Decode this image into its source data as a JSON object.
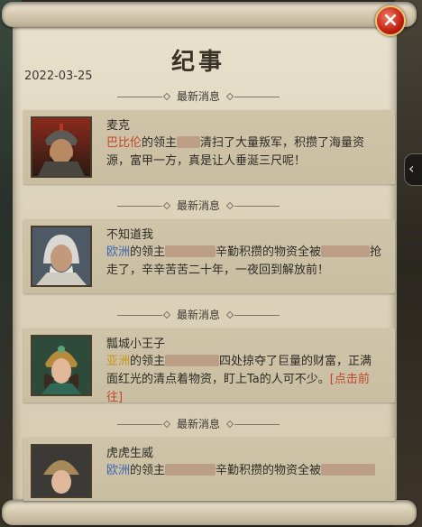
{
  "window": {
    "title": "纪事",
    "date": "2022-03-25",
    "close_icon": "×",
    "side_arrow_icon": "‹"
  },
  "section_label": "最新消息",
  "entries": [
    {
      "name": "麦克",
      "region": "巴比伦",
      "region_color": "#c1472c",
      "text1": "的领主",
      "text2": "清扫了大量叛军，积攒了海量资源，富甲一方，真是让人垂涎三尺呢！"
    },
    {
      "name": "不知道我",
      "region": "欧洲",
      "region_color": "#3f68b0",
      "text1": "的领主",
      "text2": "辛勤积攒的物资全被",
      "text3": "抢走了，辛辛苦苦二十年，一夜回到解放前！"
    },
    {
      "name": "瓢城小王子",
      "region": "亚洲",
      "region_color": "#c2951b",
      "text1": "的领主",
      "text2": "四处掠夺了巨量的财富，正满面红光的清点着物资，盯上Ta的人可不少。",
      "link": "[点击前往]"
    },
    {
      "name": "虎虎生威",
      "region": "欧洲",
      "region_color": "#3f68b0",
      "text1": "的领主",
      "text2": "辛勤积攒的物资全被"
    }
  ]
}
